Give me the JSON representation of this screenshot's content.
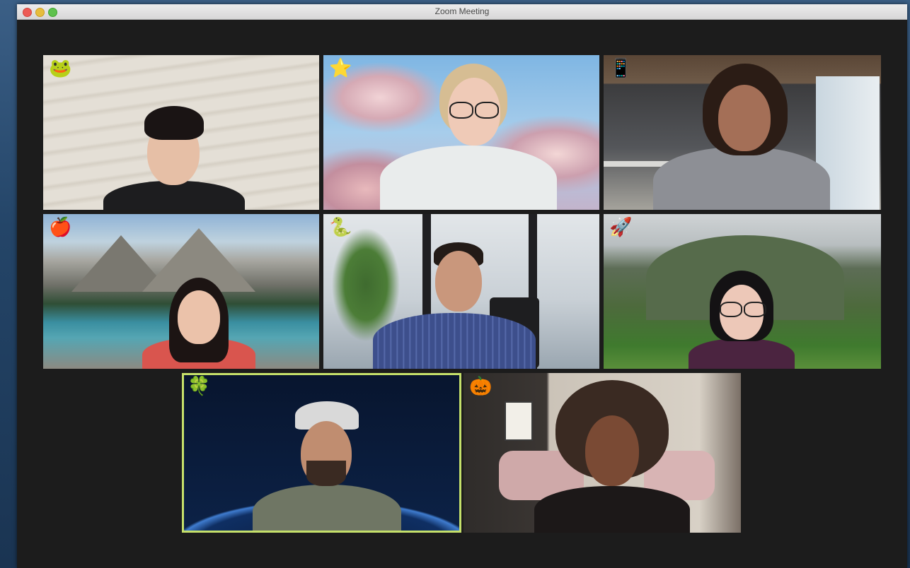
{
  "window": {
    "title": "Zoom Meeting"
  },
  "participants": [
    {
      "emoji": "🐸",
      "emoji_name": "frog-icon",
      "background": "sand"
    },
    {
      "emoji": "⭐",
      "emoji_name": "star-icon",
      "background": "clouds"
    },
    {
      "emoji": "📱",
      "emoji_name": "phone-icon",
      "background": "office"
    },
    {
      "emoji": "🍎",
      "emoji_name": "apple-icon",
      "background": "mountain-lake"
    },
    {
      "emoji": "🐍",
      "emoji_name": "snake-icon",
      "background": "window-plants"
    },
    {
      "emoji": "🚀",
      "emoji_name": "rocket-icon",
      "background": "green-mountain"
    },
    {
      "emoji": "🍀",
      "emoji_name": "clover-icon",
      "background": "earth-space",
      "active_speaker": true
    },
    {
      "emoji": "🎃",
      "emoji_name": "pumpkin-icon",
      "background": "living-room"
    }
  ],
  "colors": {
    "active_speaker_border": "#c5e06a",
    "window_bg": "#1b1b1b"
  }
}
